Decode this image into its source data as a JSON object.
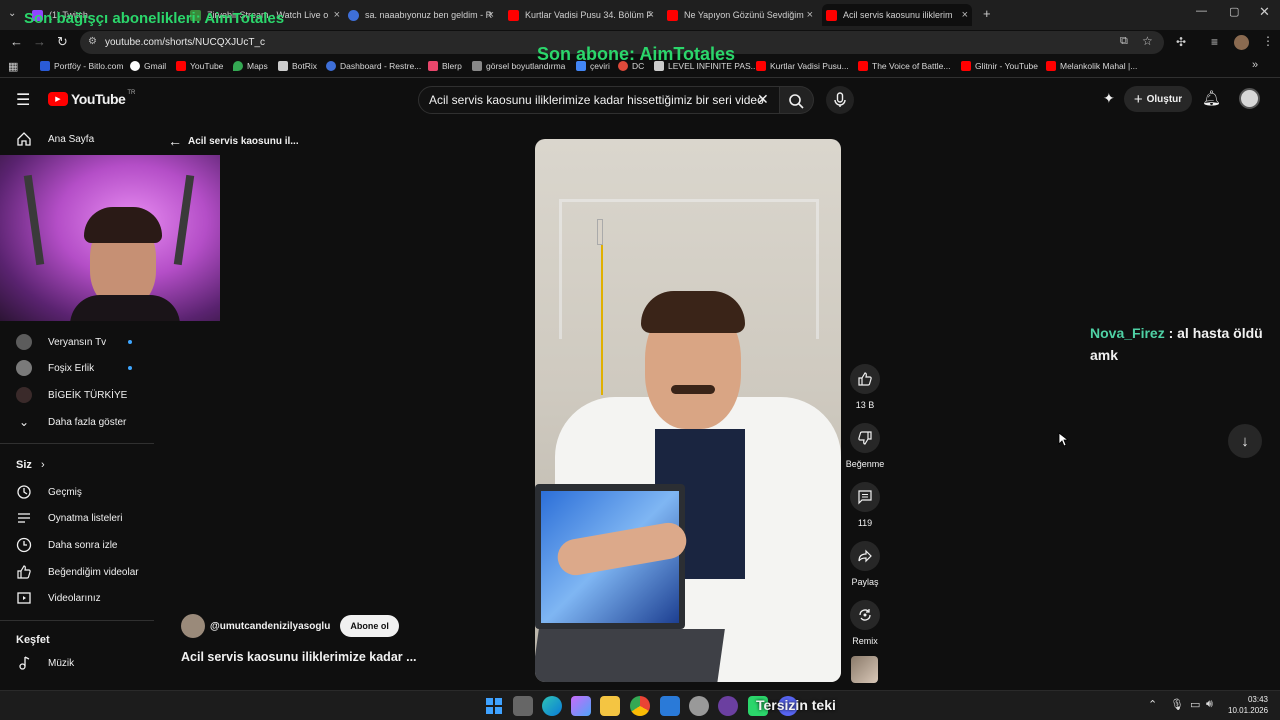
{
  "browser": {
    "tabs": [
      {
        "title": "(1) Twitch",
        "color": "#9146ff"
      },
      {
        "title": "Zirvebir Stream - Watch Live o",
        "color": "#3a8a3a"
      },
      {
        "title": "sa. naaabıyonuz ben geldim - R",
        "color": "#3e6fd8"
      },
      {
        "title": "Kurtlar Vadisi Pusu 34. Bölüm F",
        "color": "#ff0000"
      },
      {
        "title": "Ne Yapıyon Gözünü Sevdiğim",
        "color": "#ff0000"
      },
      {
        "title": "Acil servis kaosunu iliklerim",
        "color": "#ff0000"
      }
    ],
    "url": "youtube.com/shorts/NUCQXJUcT_c",
    "bookmarks": [
      {
        "label": "Portföy - Bitlo.com",
        "color": "#2a5bd7"
      },
      {
        "label": "Gmail",
        "color": "#ffffff"
      },
      {
        "label": "YouTube",
        "color": "#ff0000"
      },
      {
        "label": "Maps",
        "color": "#34a853"
      },
      {
        "label": "BotRix",
        "color": "#cccccc"
      },
      {
        "label": "Dashboard - Restre...",
        "color": "#3e6fd8"
      },
      {
        "label": "Blerp",
        "color": "#e8466b"
      },
      {
        "label": "görsel boyutlandırma",
        "color": "#888888"
      },
      {
        "label": "çeviri",
        "color": "#4285f4"
      },
      {
        "label": "DC",
        "color": "#e04a3b"
      },
      {
        "label": "LEVEL INFINITE PAS...",
        "color": "#cccccc"
      },
      {
        "label": "Kurtlar Vadisi Pusu...",
        "color": "#ff0000"
      },
      {
        "label": "The Voice of Battle...",
        "color": "#ff0000"
      },
      {
        "label": "Glitnir - YouTube",
        "color": "#ff0000"
      },
      {
        "label": "Melankolik Mahal |...",
        "color": "#ff0000"
      }
    ]
  },
  "youtube": {
    "logo_text": "YouTube",
    "logo_region": "TR",
    "search_value": "Acil servis kaosunu iliklerimize kadar hissettiğimiz bir seri video",
    "create_label": "Oluştur",
    "back_title": "Acil servis kaosunu il...",
    "sidebar": {
      "home": "Ana Sayfa",
      "subs": [
        {
          "name": "Veryansın Tv",
          "color": "#5c5c5c"
        },
        {
          "name": "Foşix Erlik",
          "color": "#7a7a7a"
        },
        {
          "name": "BİGEİK TÜRKİYE",
          "color": "#3a2a2a"
        }
      ],
      "show_more": "Daha fazla göster",
      "you_heading": "Siz",
      "you_items": [
        "Geçmiş",
        "Oynatma listeleri",
        "Daha sonra izle",
        "Beğendiğim videolar",
        "Videolarınız"
      ],
      "explore_heading": "Keşfet",
      "explore_items": [
        "Müzik"
      ]
    },
    "short": {
      "channel": "@umutcandenizilyasoglu",
      "subscribe": "Abone ol",
      "title": "Acil servis kaosunu iliklerimize kadar ...",
      "likes": "13 B",
      "dislike_label": "Beğenme",
      "comments": "119",
      "share_label": "Paylaş",
      "remix_label": "Remix"
    }
  },
  "overlay": {
    "donor_text": "Son bağışçı abonelikleri: AimTotales",
    "sub_text": "Son abone: AimTotales",
    "chat_user": "Nova_Firez",
    "chat_message": ": al hasta öldü amk",
    "chat_user_color": "#4fd1a5",
    "bottom_text": "Tersizin teki"
  },
  "taskbar": {
    "time": "03:43",
    "date": "10.01.2026"
  }
}
